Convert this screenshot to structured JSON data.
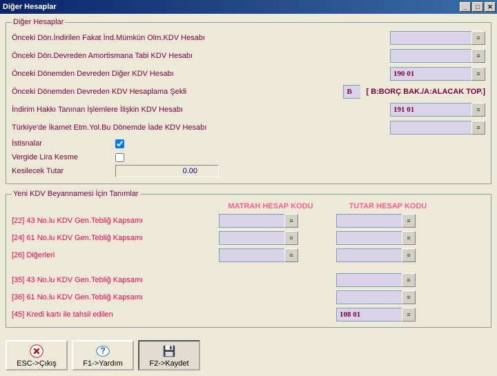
{
  "window": {
    "title": "Diğer Hesaplar"
  },
  "section1": {
    "legend": "Diğer Hesaplar",
    "rows": {
      "r1": {
        "label": "Önceki Dön.İndirilen Fakat İnd.Mümkün Olm.KDV Hesabı",
        "value": ""
      },
      "r2": {
        "label": "Önceki Dön.Devreden Amortismana Tabi KDV Hesabı",
        "value": ""
      },
      "r3": {
        "label": "Önceki Dönemden Devreden Diğer KDV Hesabı",
        "value": "190 01"
      },
      "r4": {
        "label": "Önceki Dönemden Devreden KDV Hesaplama Şekli",
        "value": "B",
        "note": "[ B:BORÇ BAK./A:ALACAK TOP.]"
      },
      "r5": {
        "label": "İndirim Hakkı Tanınan İşlemlere İlişkin KDV Hesabı",
        "value": "191 01"
      },
      "r6": {
        "label": "Türkiye'de İkamet Etm.Yol.Bu Dönemde İade KDV Hesabı",
        "value": ""
      },
      "istisnalar": {
        "label": "İstisnalar",
        "checked": true
      },
      "vergide": {
        "label": "Vergide Lira Kesme",
        "checked": false
      },
      "tutar": {
        "label": "Kesilecek Tutar",
        "value": "0.00"
      }
    }
  },
  "section2": {
    "legend": "Yeni KDV Beyannamesi İçin Tanımlar",
    "col1": "MATRAH HESAP KODU",
    "col2": "TUTAR HESAP KODU",
    "rows": [
      {
        "label": "[22] 43 No.lu KDV Gen.Tebliğ Kapsamı",
        "matrah": "",
        "tutar": ""
      },
      {
        "label": "[24] 61 No.lu KDV Gen.Tebliğ Kapsamı",
        "matrah": "",
        "tutar": ""
      },
      {
        "label": "[26] Diğerleri",
        "matrah": "",
        "tutar": ""
      },
      {
        "label": "[35] 43 No.lu KDV Gen.Tebliğ Kapsamı",
        "tutar": ""
      },
      {
        "label": "[36] 61 No.lu KDV Gen.Tebliğ Kapsamı",
        "tutar": ""
      },
      {
        "label": "[45] Kredi kartı ile tahsil edilen",
        "tutar": "108 01"
      }
    ]
  },
  "buttons": {
    "esc": "ESC->Çıkış",
    "f1": "F1->Yardım",
    "f2": "F2->Kaydet"
  }
}
